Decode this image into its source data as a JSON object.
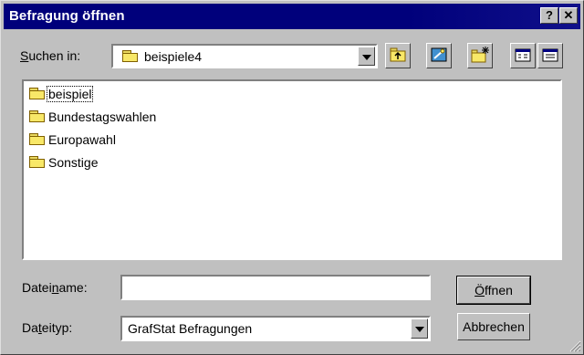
{
  "window": {
    "title": "Befragung öffnen"
  },
  "titlebar": {
    "help_label": "?",
    "close_label": "✕"
  },
  "look_in": {
    "label_prefix": "S",
    "label_rest": "uchen in:",
    "value": "beispiele4"
  },
  "toolbar": {
    "icons": [
      "up-folder-icon",
      "desktop-icon",
      "new-folder-icon",
      "list-view-icon",
      "details-view-icon"
    ]
  },
  "files": [
    {
      "name": "beispiel",
      "type": "folder"
    },
    {
      "name": "Bundestagswahlen",
      "type": "folder"
    },
    {
      "name": "Europawahl",
      "type": "folder"
    },
    {
      "name": "Sonstige",
      "type": "folder"
    }
  ],
  "filename": {
    "label_a": "Datei",
    "label_u": "n",
    "label_b": "ame:",
    "value": ""
  },
  "filetype": {
    "label_a": "Da",
    "label_u": "t",
    "label_b": "eityp:",
    "value": "GrafStat Befragungen"
  },
  "buttons": {
    "open_u": "Ö",
    "open_rest": "ffnen",
    "cancel": "Abbrechen"
  },
  "colors": {
    "titlebar": "#00007b",
    "face": "#c0c0c0",
    "folder": "#f8e868"
  }
}
